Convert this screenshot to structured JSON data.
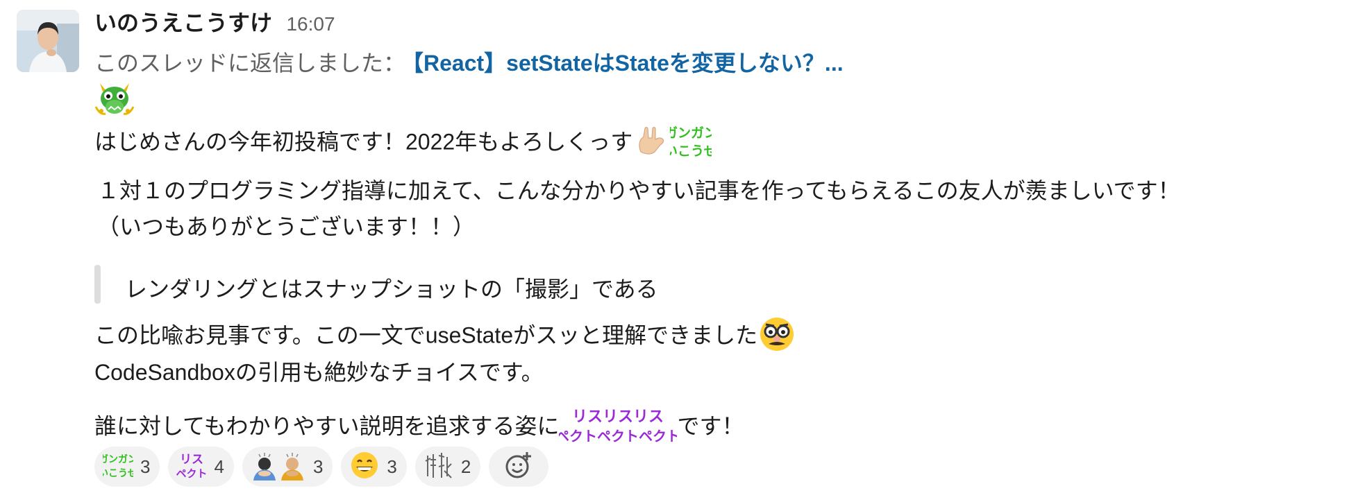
{
  "message": {
    "author": "いのうえこうすけ",
    "time": "16:07",
    "thread_prefix": "このスレッドに返信しました：",
    "thread_title": "【React】setStateはStateを変更しない？...",
    "line1": "はじめさんの今年初投稿です！2022年もよろしくっす",
    "line2": "１対１のプログラミング指導に加えて、こんな分かりやすい記事を作ってもらえるこの友人が羨ましいです！",
    "line3": "（いつもありがとうございます！！）",
    "quote": "レンダリングとはスナップショットの「撮影」である",
    "line4": "この比喩お見事です。この一文でuseStateがスッと理解できました",
    "line5": "CodeSandboxの引用も絶妙なチョイスです。",
    "line6_before": "誰に対してもわかりやすい説明を追求する姿に",
    "line6_after": "です！",
    "sticker_gangan": "ガンガンいこうぜ",
    "sticker_respect": "リスペクト"
  },
  "reactions": [
    {
      "icon": "gangan-ikouze-emoji",
      "count": "3"
    },
    {
      "icon": "respect-emoji",
      "count": "4"
    },
    {
      "icon": "bowing-people-emoji",
      "count": "3"
    },
    {
      "icon": "grinning-face-emoji",
      "count": "3"
    },
    {
      "icon": "shinshi-emoji",
      "count": "2"
    }
  ],
  "colors": {
    "link": "#1264a3",
    "gangan_green": "#2fc01d",
    "respect_purple": "#9b29d8",
    "reaction_bg": "#f2f2f2"
  }
}
